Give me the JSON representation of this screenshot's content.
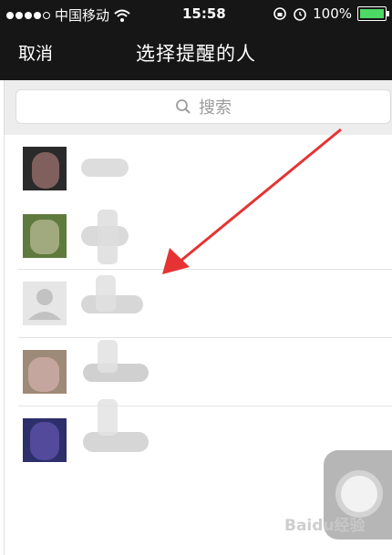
{
  "status_bar": {
    "carrier": "中国移动",
    "time": "15:58",
    "battery": "100%"
  },
  "nav": {
    "cancel_label": "取消",
    "title": "选择提醒的人"
  },
  "search": {
    "placeholder": "搜索"
  },
  "contacts": [
    {
      "name": ""
    },
    {
      "name": ""
    },
    {
      "name": ""
    },
    {
      "name": ""
    },
    {
      "name": ""
    }
  ],
  "colors": {
    "bar_bg": "#161616",
    "arrow": "#e53333",
    "battery_green": "#4cd964"
  },
  "watermark": "Baidu经验"
}
